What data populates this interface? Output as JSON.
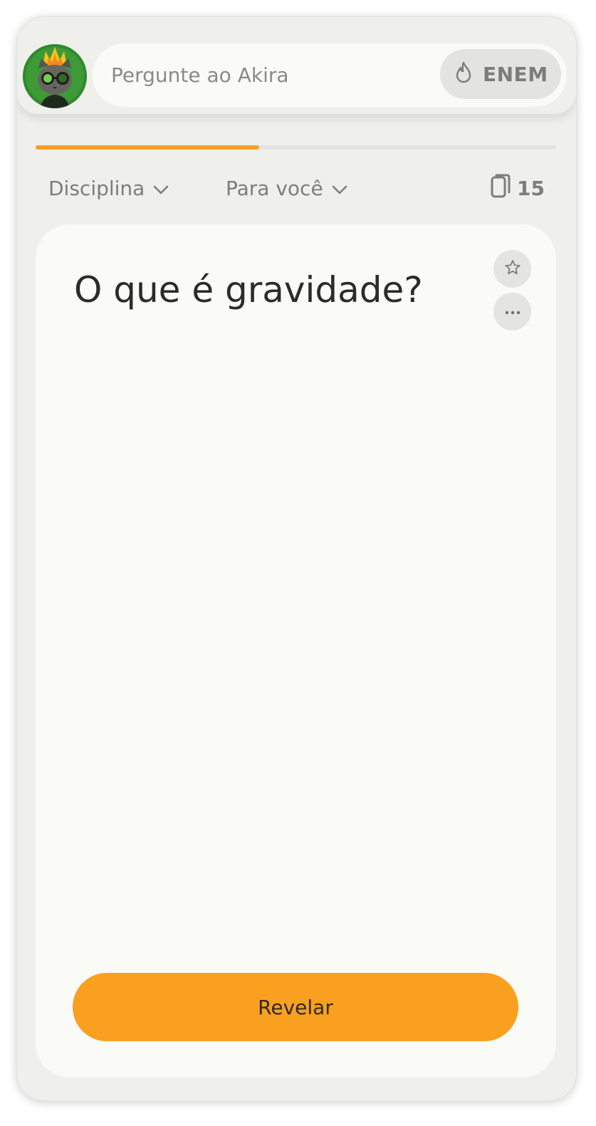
{
  "search": {
    "placeholder": "Pergunte ao Akira",
    "exam_label": "ENEM",
    "exam_icon": "flame-icon"
  },
  "progress": {
    "fraction": 0.43,
    "color": "#f8a023"
  },
  "filters": {
    "discipline_label": "Disciplina",
    "audience_label": "Para você",
    "deck_count": "15"
  },
  "card": {
    "question": "O que é gravidade?",
    "reveal_label": "Revelar",
    "favorite_icon": "star-icon",
    "more_icon": "more-dots-icon"
  },
  "colors": {
    "accent": "#f9a020",
    "background": "#efefec",
    "card": "#fafaf7"
  }
}
